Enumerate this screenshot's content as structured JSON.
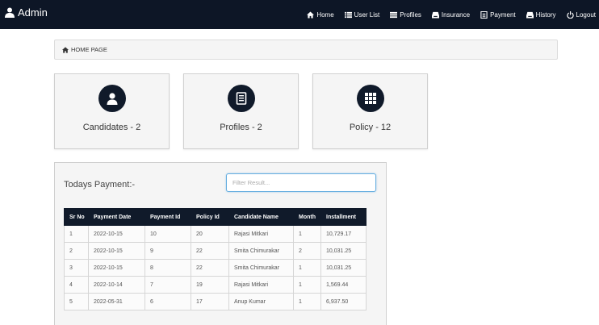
{
  "brand": {
    "label": "Admin",
    "icon": "user-icon"
  },
  "nav": [
    {
      "label": "Home",
      "icon": "home-icon"
    },
    {
      "label": "User List",
      "icon": "list-icon"
    },
    {
      "label": "Profiles",
      "icon": "list-icon"
    },
    {
      "label": "Insurance",
      "icon": "inbox-icon"
    },
    {
      "label": "Payment",
      "icon": "document-icon"
    },
    {
      "label": "History",
      "icon": "inbox-icon"
    },
    {
      "label": "Logout",
      "icon": "power-icon"
    }
  ],
  "breadcrumb": {
    "label": "HOME PAGE",
    "icon": "home-icon"
  },
  "cards": [
    {
      "label": "Candidates - 2",
      "icon": "user-icon"
    },
    {
      "label": "Profiles - 2",
      "icon": "document-icon"
    },
    {
      "label": "Policy - 12",
      "icon": "grid-icon"
    }
  ],
  "payments": {
    "title": "Todays Payment:-",
    "filter_placeholder": "Filter Result...",
    "columns": [
      "Sr No",
      "Payment Date",
      "Payment Id",
      "Policy Id",
      "Candidate Name",
      "Month",
      "Installment"
    ],
    "rows": [
      [
        "1",
        "2022-10-15",
        "10",
        "20",
        "Rajasi Mitkari",
        "1",
        "10,729.17"
      ],
      [
        "2",
        "2022-10-15",
        "9",
        "22",
        "Smita Chimurakar",
        "2",
        "10,031.25"
      ],
      [
        "3",
        "2022-10-15",
        "8",
        "22",
        "Smita Chimurakar",
        "1",
        "10,031.25"
      ],
      [
        "4",
        "2022-10-14",
        "7",
        "19",
        "Rajasi Mitkari",
        "1",
        "1,569.44"
      ],
      [
        "5",
        "2022-05-31",
        "6",
        "17",
        "Anup Kumar",
        "1",
        "6,937.50"
      ]
    ]
  },
  "colors": {
    "navbar": "#0d1626",
    "accent": "#101a2a",
    "panel": "#f5f5f5",
    "filter_border": "#66aee0"
  }
}
